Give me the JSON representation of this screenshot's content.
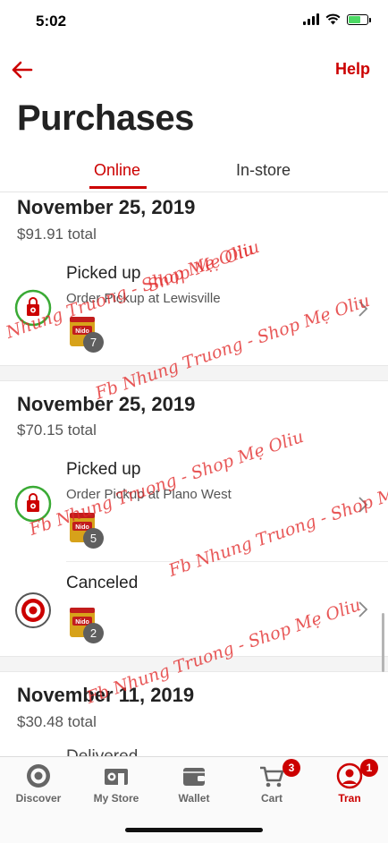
{
  "status_bar": {
    "time": "5:02"
  },
  "header": {
    "help_label": "Help"
  },
  "page": {
    "title": "Purchases"
  },
  "tabs": [
    {
      "label": "Online",
      "active": true
    },
    {
      "label": "In-store",
      "active": false
    }
  ],
  "orders": [
    {
      "date": "November 25, 2019",
      "total": "$91.91 total",
      "shipments": [
        {
          "status": "Picked up",
          "store": "Order Pickup at Lewisville",
          "icon": "pickup-bag-icon",
          "quantity": "7"
        }
      ]
    },
    {
      "date": "November 25, 2019",
      "total": "$70.15 total",
      "shipments": [
        {
          "status": "Picked up",
          "store": "Order Pickup at Plano West",
          "icon": "pickup-bag-icon",
          "quantity": "5"
        },
        {
          "status": "Canceled",
          "store": "",
          "icon": "target-logo-icon",
          "quantity": "2"
        }
      ]
    },
    {
      "date": "November 11, 2019",
      "total": "$30.48 total",
      "shipments": []
    }
  ],
  "product_label": "Nido",
  "tab_bar": [
    {
      "label": "Discover",
      "icon": "target-bullseye-icon",
      "badge": ""
    },
    {
      "label": "My Store",
      "icon": "store-icon",
      "badge": ""
    },
    {
      "label": "Wallet",
      "icon": "wallet-icon",
      "badge": ""
    },
    {
      "label": "Cart",
      "icon": "cart-icon",
      "badge": "3"
    },
    {
      "label": "Tran",
      "icon": "account-icon",
      "badge": "1",
      "active": true
    }
  ],
  "watermarks": [
    "Shop Mẹ Oliu",
    "Nhung Truong - Shop Mẹ Oliu",
    "Fb Nhung Truong - Shop Mẹ Oliu",
    "Fb Nhung Truong - Shop Mẹ Oliu",
    "Fb Nhung Truong - Shop Mẹ Oliu",
    "Fb Nhung Truong - Shop Mẹ Oliu"
  ],
  "colors": {
    "accent": "#cc0000",
    "pickup_ring": "#3aaa35",
    "badge": "#5f5f5f"
  }
}
